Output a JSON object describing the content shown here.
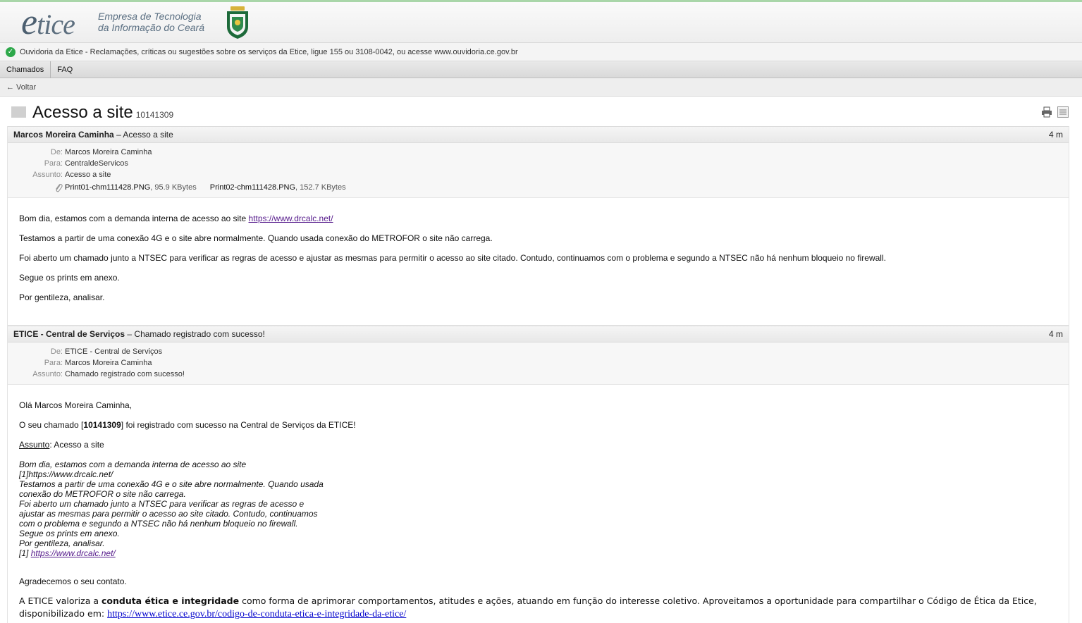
{
  "header": {
    "logo_e": "e",
    "logo_rest": "tice",
    "company_line1": "Empresa de Tecnologia",
    "company_line2": "da Informação do Ceará"
  },
  "ouvidoria": {
    "text": "Ouvidoria da Etice - Reclamações, críticas ou sugestões sobre os serviços da Etice, ligue 155 ou 3108-0042, ou acesse www.ouvidoria.ce.gov.br"
  },
  "nav": {
    "items": [
      "Chamados",
      "FAQ"
    ]
  },
  "back": {
    "label": "← Voltar"
  },
  "ticket": {
    "title": "Acesso a site",
    "number": "10141309"
  },
  "messages": [
    {
      "sender": "Marcos Moreira Caminha",
      "subject_suffix": "– Acesso a site",
      "time": "4 m",
      "labels": {
        "from": "De:",
        "to": "Para:",
        "subject": "Assunto:"
      },
      "from": "Marcos Moreira Caminha",
      "to": "CentraldeServicos",
      "subject": "Acesso a site",
      "attachments": [
        {
          "name": "Print01-chm111428.PNG",
          "size": ", 95.9 KBytes"
        },
        {
          "name": "Print02-chm111428.PNG",
          "size": ", 152.7 KBytes"
        }
      ],
      "body": {
        "p1_text": "Bom dia, estamos com a demanda interna de acesso ao site ",
        "p1_link": "https://www.drcalc.net/",
        "p2": "Testamos a partir de uma conexão 4G e o site abre normalmente. Quando usada conexão do METROFOR  o site não carrega.",
        "p3": "Foi aberto um chamado junto a NTSEC para verificar as regras de acesso e ajustar as mesmas para permitir o acesso ao site citado. Contudo, continuamos com o problema e segundo a NTSEC não há nenhum bloqueio no firewall.",
        "p4": "Segue os prints em anexo.",
        "p5": "Por gentileza, analisar."
      }
    },
    {
      "sender": "ETICE - Central de Serviços",
      "subject_suffix": "– Chamado registrado com sucesso!",
      "time": "4 m",
      "labels": {
        "from": "De:",
        "to": "Para:",
        "subject": "Assunto:"
      },
      "from": "ETICE - Central de Serviços",
      "to": "Marcos Moreira Caminha",
      "subject": "Chamado registrado com sucesso!",
      "body": {
        "greeting": "Olá Marcos Moreira Caminha,",
        "reg_prefix": "O seu chamado [",
        "reg_number": "10141309",
        "reg_suffix": "] foi registrado com sucesso na Central de Serviços da ETICE!",
        "assunto_label": "Assunto",
        "assunto_value": ": Acesso a site",
        "quoted_lines": [
          "Bom dia, estamos com a demanda interna de acesso ao site",
          "[1]https://www.drcalc.net/",
          "Testamos a partir de uma conexão 4G e o site abre normalmente. Quando usada",
          "conexão do METROFOR  o site não carrega.",
          "Foi aberto um chamado junto a NTSEC para verificar as regras de acesso e",
          "ajustar as mesmas para permitir o acesso ao site citado. Contudo, continuamos",
          "com o problema e segundo a NTSEC não há nenhum bloqueio no firewall.",
          "Segue os prints em anexo.",
          "Por gentileza, analisar."
        ],
        "quoted_ref_prefix": "[1] ",
        "quoted_ref_link": "https://www.drcalc.net/",
        "thanks": "Agradecemos o seu contato.",
        "footer_prefix": "A ETICE valoriza a ",
        "footer_bold": "conduta ética e integridade",
        "footer_suffix": " como forma de aprimorar comportamentos, atitudes e ações, atuando em função do interesse coletivo.  Aproveitamos a oportunidade para compartilhar o Código de Ética da Etice, disponibilizado em: ",
        "footer_link": "https://www.etice.ce.gov.br/codigo-de-conduta-etica-e-integridade-da-etice/"
      }
    }
  ]
}
